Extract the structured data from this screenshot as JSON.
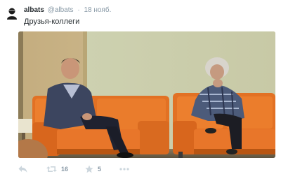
{
  "tweet": {
    "fullname": "albats",
    "username": "@albats",
    "separator": "·",
    "date": "18 нояб.",
    "text": "Друзья-коллеги",
    "retweet_count": "16",
    "favorite_count": "5"
  },
  "icons": {
    "avatar": "avatar-icon",
    "reply": "reply-icon",
    "retweet": "retweet-icon",
    "favorite": "star-icon",
    "more": "more-icon"
  },
  "colors": {
    "name": "#292f33",
    "meta": "#8899a6",
    "icon": "#ccd6dd",
    "sofa": "#e8762a"
  }
}
